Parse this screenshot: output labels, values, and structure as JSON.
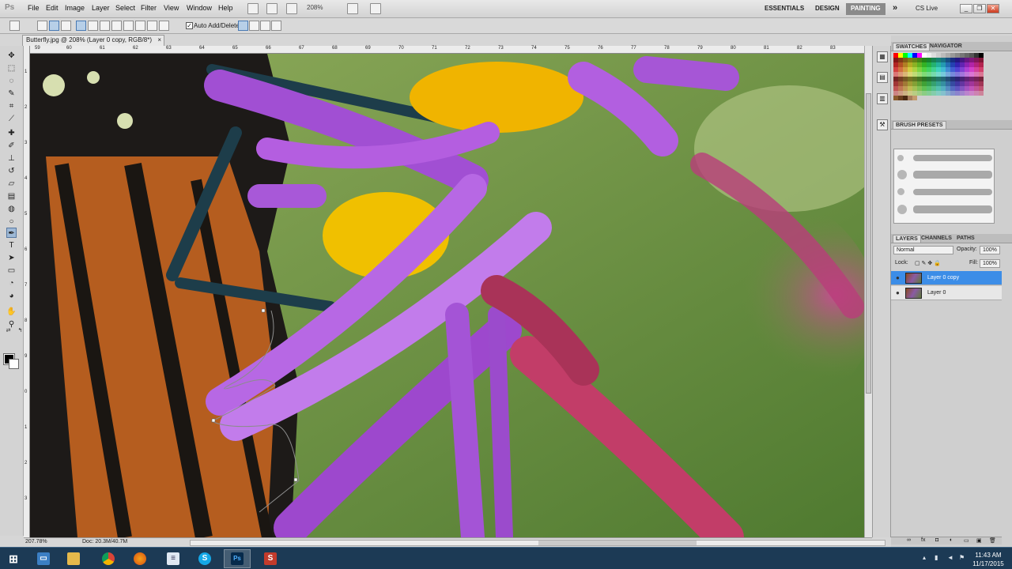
{
  "app": {
    "logo": "Ps"
  },
  "menus": [
    "File",
    "Edit",
    "Image",
    "Layer",
    "Select",
    "Filter",
    "View",
    "Window",
    "Help"
  ],
  "menubar": {
    "zoom_value": "208%",
    "workspaces": [
      "ESSENTIALS",
      "DESIGN",
      "PAINTING"
    ],
    "active_workspace": "PAINTING",
    "cslive": "CS Live"
  },
  "options": {
    "auto_add_delete": "Auto Add/Delete",
    "auto_add_checked": true
  },
  "document": {
    "tab_title": "Butterfly.jpg @ 208% (Layer 0 copy, RGB/8*)",
    "close": "×"
  },
  "rulers": {
    "top": [
      "59",
      "60",
      "61",
      "62",
      "63",
      "64",
      "65",
      "66",
      "67",
      "68",
      "69",
      "70",
      "71",
      "72",
      "73",
      "74",
      "75",
      "76",
      "77",
      "78",
      "79",
      "80",
      "81",
      "82",
      "83"
    ],
    "left": [
      "1",
      "2",
      "3",
      "4",
      "5",
      "6",
      "7",
      "8",
      "9",
      "0",
      "1",
      "2",
      "3"
    ]
  },
  "status": {
    "zoom": "207.78%",
    "doc": "Doc: 20.3M/40.7M"
  },
  "panels": {
    "swatch_tabs": [
      "SWATCHES",
      "NAVIGATOR"
    ],
    "brush_tab": "BRUSH PRESETS",
    "layer_tabs": [
      "LAYERS",
      "CHANNELS",
      "PATHS"
    ],
    "blend_mode": "Normal",
    "opacity_label": "Opacity:",
    "opacity_value": "100%",
    "lock_label": "Lock:",
    "fill_label": "Fill:",
    "fill_value": "100%",
    "layers": [
      {
        "name": "Layer 0 copy",
        "selected": true
      },
      {
        "name": "Layer 0",
        "selected": false
      }
    ]
  },
  "taskbar": {
    "time": "11:43 AM",
    "date": "11/17/2015",
    "apps": [
      "windows-start",
      "explorer",
      "folder",
      "chrome",
      "firefox",
      "notepad",
      "skype",
      "photoshop",
      "snagit"
    ]
  },
  "colors": {
    "accent": "#3c8de7",
    "taskbar": "#1c3a55",
    "foreground_color": "#000000",
    "background_color": "#ffffff"
  }
}
